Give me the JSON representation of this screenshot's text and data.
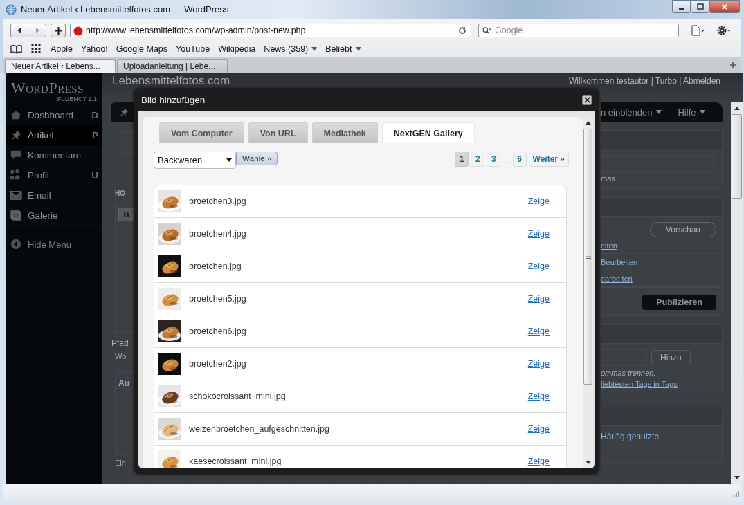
{
  "window": {
    "title": "Neuer Artikel ‹ Lebensmittelfotos.com — WordPress"
  },
  "toolbar": {
    "address": "http://www.lebensmittelfotos.com/wp-admin/post-new.php",
    "search": {
      "placeholder": "Google"
    }
  },
  "bookmarks": [
    {
      "label": "Apple",
      "kind": "link"
    },
    {
      "label": "Yahoo!",
      "kind": "link"
    },
    {
      "label": "Google Maps",
      "kind": "link"
    },
    {
      "label": "YouTube",
      "kind": "link"
    },
    {
      "label": "Wikipedia",
      "kind": "link"
    },
    {
      "label": "News (359)",
      "kind": "menu"
    },
    {
      "label": "Beliebt",
      "kind": "menu"
    }
  ],
  "tabs": [
    {
      "label": "Neuer Artikel ‹ Lebens...",
      "selected": true
    },
    {
      "label": "Uploadanleitung | Lebe...",
      "selected": false
    }
  ],
  "page": {
    "logo": "WordPress",
    "logo_sub": "FLUENCY 2.1",
    "site_title": "Lebensmittelfotos.com",
    "user_links": "Willkommen testautor | Turbo | Abmelden",
    "sidebar": {
      "items": [
        {
          "label": "Dashboard",
          "shortcut": "D",
          "selected": false
        },
        {
          "label": "Artikel",
          "shortcut": "P",
          "selected": true
        },
        {
          "label": "Kommentare",
          "selected": false
        },
        {
          "label": "Profil",
          "shortcut": "U",
          "selected": false
        },
        {
          "label": "Email",
          "selected": false
        },
        {
          "label": "Galerie",
          "selected": false
        }
      ],
      "hide_menu": "Hide Menu"
    },
    "left_fragments": {
      "heading": "HO",
      "bold_button": "B",
      "path": "Pfad",
      "word": "Wo",
      "box_title": "Au",
      "note": "Ein"
    },
    "right_fragments": {
      "menu": [
        "n einblenden",
        "Hilfe"
      ],
      "hint": "mas",
      "preview_button": "Vorschau",
      "links": [
        "eiten",
        "Bearbeiten",
        "earbeiten"
      ],
      "publish_button": "Publizieren",
      "add_button": "Hinzu",
      "tag_hint": "ommas trennen.",
      "tag_link": "liebtesten Tags in Tags",
      "category_tab": "Häufig genutzte"
    }
  },
  "modal": {
    "title": "Bild hinzufügen",
    "tabs": [
      {
        "label": "Vom Computer",
        "selected": false
      },
      {
        "label": "Von URL",
        "selected": false
      },
      {
        "label": "Mediathek",
        "selected": false
      },
      {
        "label": "NextGEN Gallery",
        "selected": true
      }
    ],
    "gallery_select": {
      "value": "Backwaren"
    },
    "choose_button": "Wähle »",
    "pages": [
      {
        "label": "1",
        "kind": "page",
        "selected": true
      },
      {
        "label": "2",
        "kind": "page",
        "selected": false
      },
      {
        "label": "3",
        "kind": "page",
        "selected": false
      },
      {
        "label": "...",
        "kind": "gap"
      },
      {
        "label": "6",
        "kind": "page",
        "selected": false
      },
      {
        "label": "Weiter »",
        "kind": "page",
        "selected": false
      }
    ],
    "images": [
      {
        "filename": "broetchen3.jpg",
        "action": "Zeige",
        "kind": "picture"
      },
      {
        "filename": "broetchen4.jpg",
        "action": "Zeige",
        "kind": "picture"
      },
      {
        "filename": "broetchen.jpg",
        "action": "Zeige",
        "kind": "picture"
      },
      {
        "filename": "broetchen5.jpg",
        "action": "Zeige",
        "kind": "picture"
      },
      {
        "filename": "broetchen6.jpg",
        "action": "Zeige",
        "kind": "picture"
      },
      {
        "filename": "broetchen2.jpg",
        "action": "Zeige",
        "kind": "picture"
      },
      {
        "filename": "schokocroissant_mini.jpg",
        "action": "Zeige",
        "kind": "picture"
      },
      {
        "filename": "weizenbroetchen_aufgeschnitten.jpg",
        "action": "Zeige",
        "kind": "picture"
      },
      {
        "filename": "kaesecroissant_mini.jpg",
        "action": "Zeige",
        "kind": "picture"
      }
    ]
  }
}
